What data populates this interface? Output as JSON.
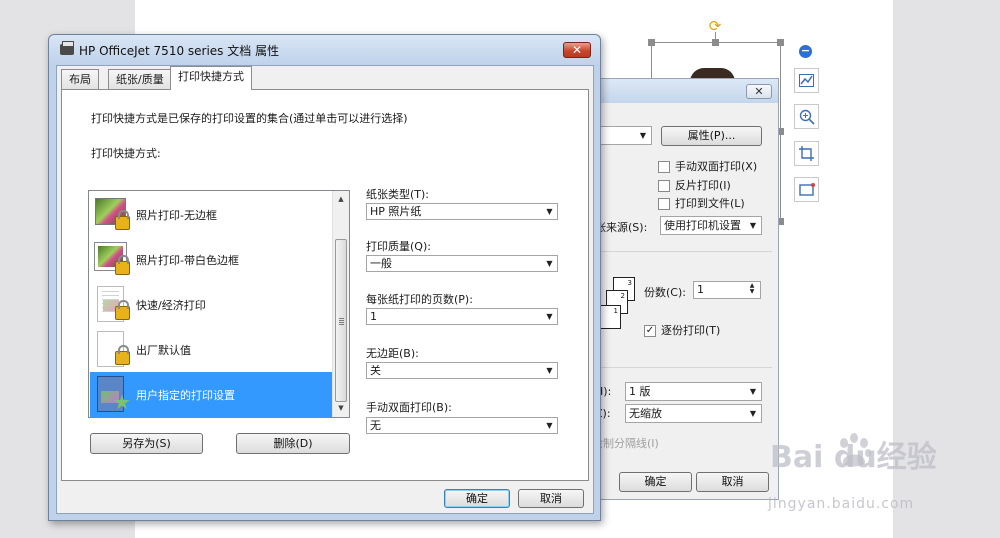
{
  "main_dialog": {
    "title": "HP OfficeJet 7510 series 文档 属性",
    "close_glyph": "✕",
    "tabs": [
      {
        "label": "布局"
      },
      {
        "label": "纸张/质量"
      },
      {
        "label": "打印快捷方式"
      }
    ],
    "description": "打印快捷方式是已保存的打印设置的集合(通过单击可以进行选择)",
    "shortcuts_label": "打印快捷方式:",
    "shortcuts": [
      {
        "label": "照片打印-无边框"
      },
      {
        "label": "照片打印-带白色边框"
      },
      {
        "label": "快速/经济打印"
      },
      {
        "label": "出厂默认值"
      },
      {
        "label": "用户指定的打印设置"
      }
    ],
    "selected_shortcut": 4,
    "settings": [
      {
        "label": "纸张类型(T):",
        "value": "HP 照片纸"
      },
      {
        "label": "打印质量(Q):",
        "value": "一般"
      },
      {
        "label": "每张纸打印的页数(P):",
        "value": "1"
      },
      {
        "label": "无边距(B):",
        "value": "关"
      },
      {
        "label": "手动双面打印(B):",
        "value": "无"
      }
    ],
    "save_as_button": "另存为(S)",
    "delete_button": "删除(D)",
    "ok_button": "确定",
    "cancel_button": "取消"
  },
  "print_dialog": {
    "close_glyph": "✕",
    "properties_button": "属性(P)...",
    "checkboxes": [
      {
        "label": "手动双面打印(X)",
        "checked": false
      },
      {
        "label": "反片打印(I)",
        "checked": false
      },
      {
        "label": "打印到文件(L)",
        "checked": false
      }
    ],
    "source_label": "张来源(S):",
    "source_value": "使用打印机设置",
    "copies_label": "份数(C):",
    "copies_value": "1",
    "collate_label": "逐份打印(T)",
    "collate_checked": true,
    "collate_check_glyph": "✓",
    "page_icons": [
      "3",
      "2",
      "1"
    ],
    "pages_per_sheet_label": "H):",
    "pages_per_sheet_value": "1 版",
    "scale_label": "Z):",
    "scale_value": "无缩放",
    "separator_label": "绘制分隔线(I)",
    "ok_button": "确定",
    "cancel_button": "取消"
  },
  "side_toolbar": {
    "collapse_glyph": "−"
  },
  "watermark": {
    "brand": "Bai du经验",
    "url": "jingyan.baidu.com"
  },
  "colors": {
    "selection": "#3399ff",
    "title_gradient": "#bfd2ea",
    "close_red": "#c9462d",
    "rotate_handle": "#e6a100"
  }
}
